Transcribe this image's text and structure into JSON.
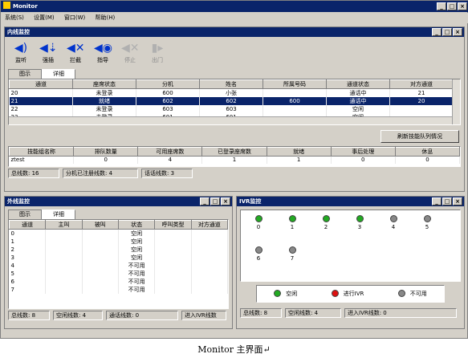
{
  "app": {
    "title": "Monitor"
  },
  "menu": [
    "系统(S)",
    "设置(M)",
    "窗口(W)",
    "帮助(H)"
  ],
  "colors": {
    "free": "#22aa22",
    "ivr": "#dd1111",
    "unavailable": "#888888",
    "titlebar": "#0a246a"
  },
  "online": {
    "title": "内线监控",
    "toolbar": [
      {
        "label": "监听",
        "icon": "listen-icon",
        "enabled": true
      },
      {
        "label": "强插",
        "icon": "barge-in-icon",
        "enabled": true
      },
      {
        "label": "拦截",
        "icon": "intercept-icon",
        "enabled": true
      },
      {
        "label": "指导",
        "icon": "coach-icon",
        "enabled": true
      },
      {
        "label": "停止",
        "icon": "stop-icon",
        "enabled": false
      },
      {
        "label": "出门",
        "icon": "exit-door-icon",
        "enabled": false
      }
    ],
    "tabs": [
      "图示",
      "详细"
    ],
    "columns": [
      "通道",
      "座席状态",
      "分机",
      "姓名",
      "所属号码",
      "通道状态",
      "对方通道"
    ],
    "rows": [
      [
        "20",
        "未登录",
        "600",
        "小张",
        "",
        "通话中",
        "21"
      ],
      [
        "21",
        "就绪",
        "602",
        "602",
        "600",
        "通话中",
        "20"
      ],
      [
        "22",
        "未登录",
        "603",
        "603",
        "",
        "空闲",
        ""
      ],
      [
        "23",
        "未登录",
        "601",
        "601",
        "",
        "空闲",
        ""
      ]
    ],
    "selected_row": 1,
    "refresh_button": "刷新技能队列情况",
    "skill_columns": [
      "技能组名称",
      "排队数量",
      "可用座席数",
      "已登录座席数",
      "就绪",
      "事后处理",
      "休息"
    ],
    "skill_rows": [
      [
        "ztest",
        "0",
        "4",
        "1",
        "1",
        "0",
        "0"
      ]
    ],
    "status": [
      "总线数: 16",
      "分机已注册线数: 4",
      "话话线数: 3"
    ]
  },
  "trunk": {
    "title": "外线监控",
    "tabs": [
      "图示",
      "详细"
    ],
    "columns": [
      "通道",
      "主叫",
      "被叫",
      "状态",
      "呼叫类型",
      "对方通道"
    ],
    "rows": [
      [
        "0",
        "",
        "",
        "空闲",
        "",
        ""
      ],
      [
        "1",
        "",
        "",
        "空闲",
        "",
        ""
      ],
      [
        "2",
        "",
        "",
        "空闲",
        "",
        ""
      ],
      [
        "3",
        "",
        "",
        "空闲",
        "",
        ""
      ],
      [
        "4",
        "",
        "",
        "不可用",
        "",
        ""
      ],
      [
        "5",
        "",
        "",
        "不可用",
        "",
        ""
      ],
      [
        "6",
        "",
        "",
        "不可用",
        "",
        ""
      ],
      [
        "7",
        "",
        "",
        "不可用",
        "",
        ""
      ]
    ],
    "status": [
      "总线数: 8",
      "空闲线数: 4",
      "通话线数: 0",
      "进入IVR线数"
    ]
  },
  "ivr": {
    "title": "IVR监控",
    "channels": [
      {
        "label": "0",
        "state": "free"
      },
      {
        "label": "1",
        "state": "free"
      },
      {
        "label": "2",
        "state": "free"
      },
      {
        "label": "3",
        "state": "free"
      },
      {
        "label": "4",
        "state": "unavailable"
      },
      {
        "label": "5",
        "state": "unavailable"
      },
      {
        "label": "6",
        "state": "unavailable"
      },
      {
        "label": "7",
        "state": "unavailable"
      }
    ],
    "legend": [
      {
        "label": "空闲",
        "state": "free"
      },
      {
        "label": "进行IVR",
        "state": "ivr"
      },
      {
        "label": "不可用",
        "state": "unavailable"
      }
    ],
    "status": [
      "总线数: 8",
      "空闲线数: 4",
      "进入IVR线数: 0"
    ]
  },
  "caption": "Monitor 主界面↵"
}
